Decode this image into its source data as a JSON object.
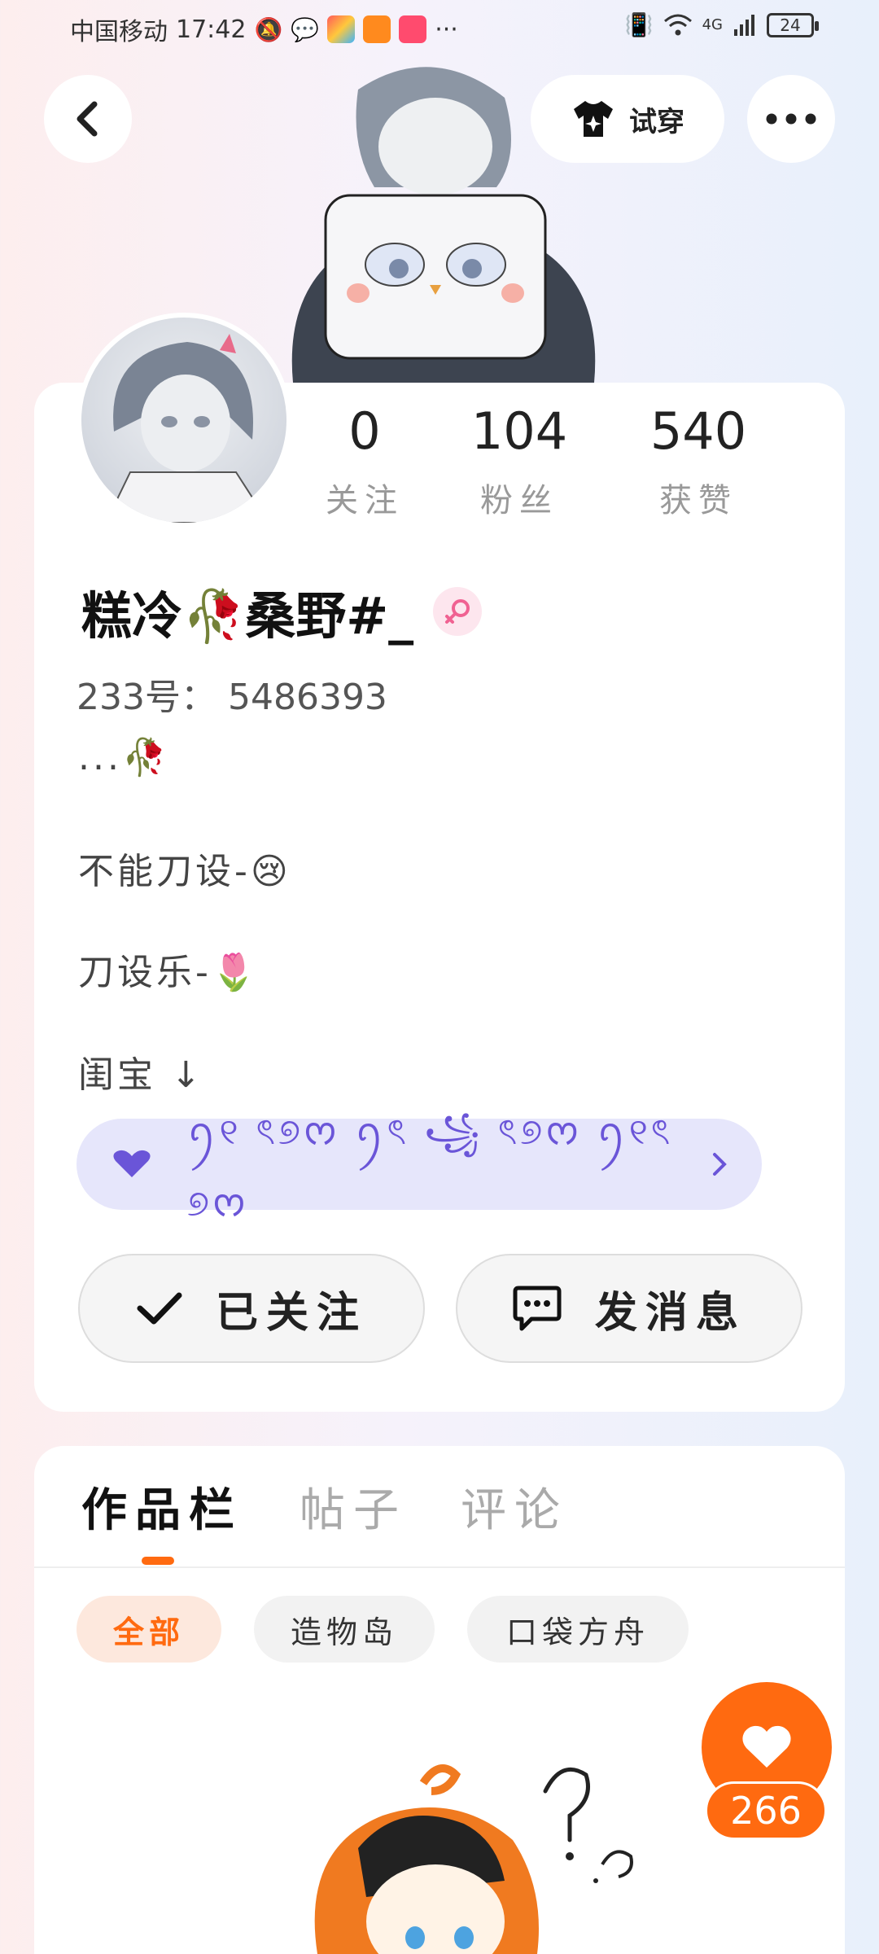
{
  "status_bar": {
    "carrier": "中国移动",
    "time": "17:42",
    "more": "···",
    "network": "4G",
    "battery": "24"
  },
  "header": {
    "try_on_label": "试穿"
  },
  "profile": {
    "stats": [
      {
        "value": "0",
        "label": "关注"
      },
      {
        "value": "104",
        "label": "粉丝"
      },
      {
        "value": "540",
        "label": "获赞"
      }
    ],
    "username": "糕冷🥀桑野#_",
    "uid": "233号： 5486393",
    "bio": [
      "...🥀",
      "不能刀设-😢",
      "刀设乐-🌷",
      "闺宝 ↓"
    ],
    "decor_text": "ꪆ୧ ৎ୭ᰔ ꪆৎ ꧁ ৎ୭ᰔ ꪆ୧ৎ ୭ᰔ",
    "follow_label": "已关注",
    "message_label": "发消息"
  },
  "tabs": [
    {
      "label": "作品栏",
      "active": true
    },
    {
      "label": "帖子",
      "active": false
    },
    {
      "label": "评论",
      "active": false
    }
  ],
  "filters": [
    {
      "label": "全部",
      "active": true
    },
    {
      "label": "造物岛",
      "active": false
    },
    {
      "label": "口袋方舟",
      "active": false
    }
  ],
  "like": {
    "count": "266"
  },
  "colors": {
    "accent": "#ff6a10",
    "decor_bg": "#e6e6fb",
    "decor_fg": "#6a55d8"
  }
}
